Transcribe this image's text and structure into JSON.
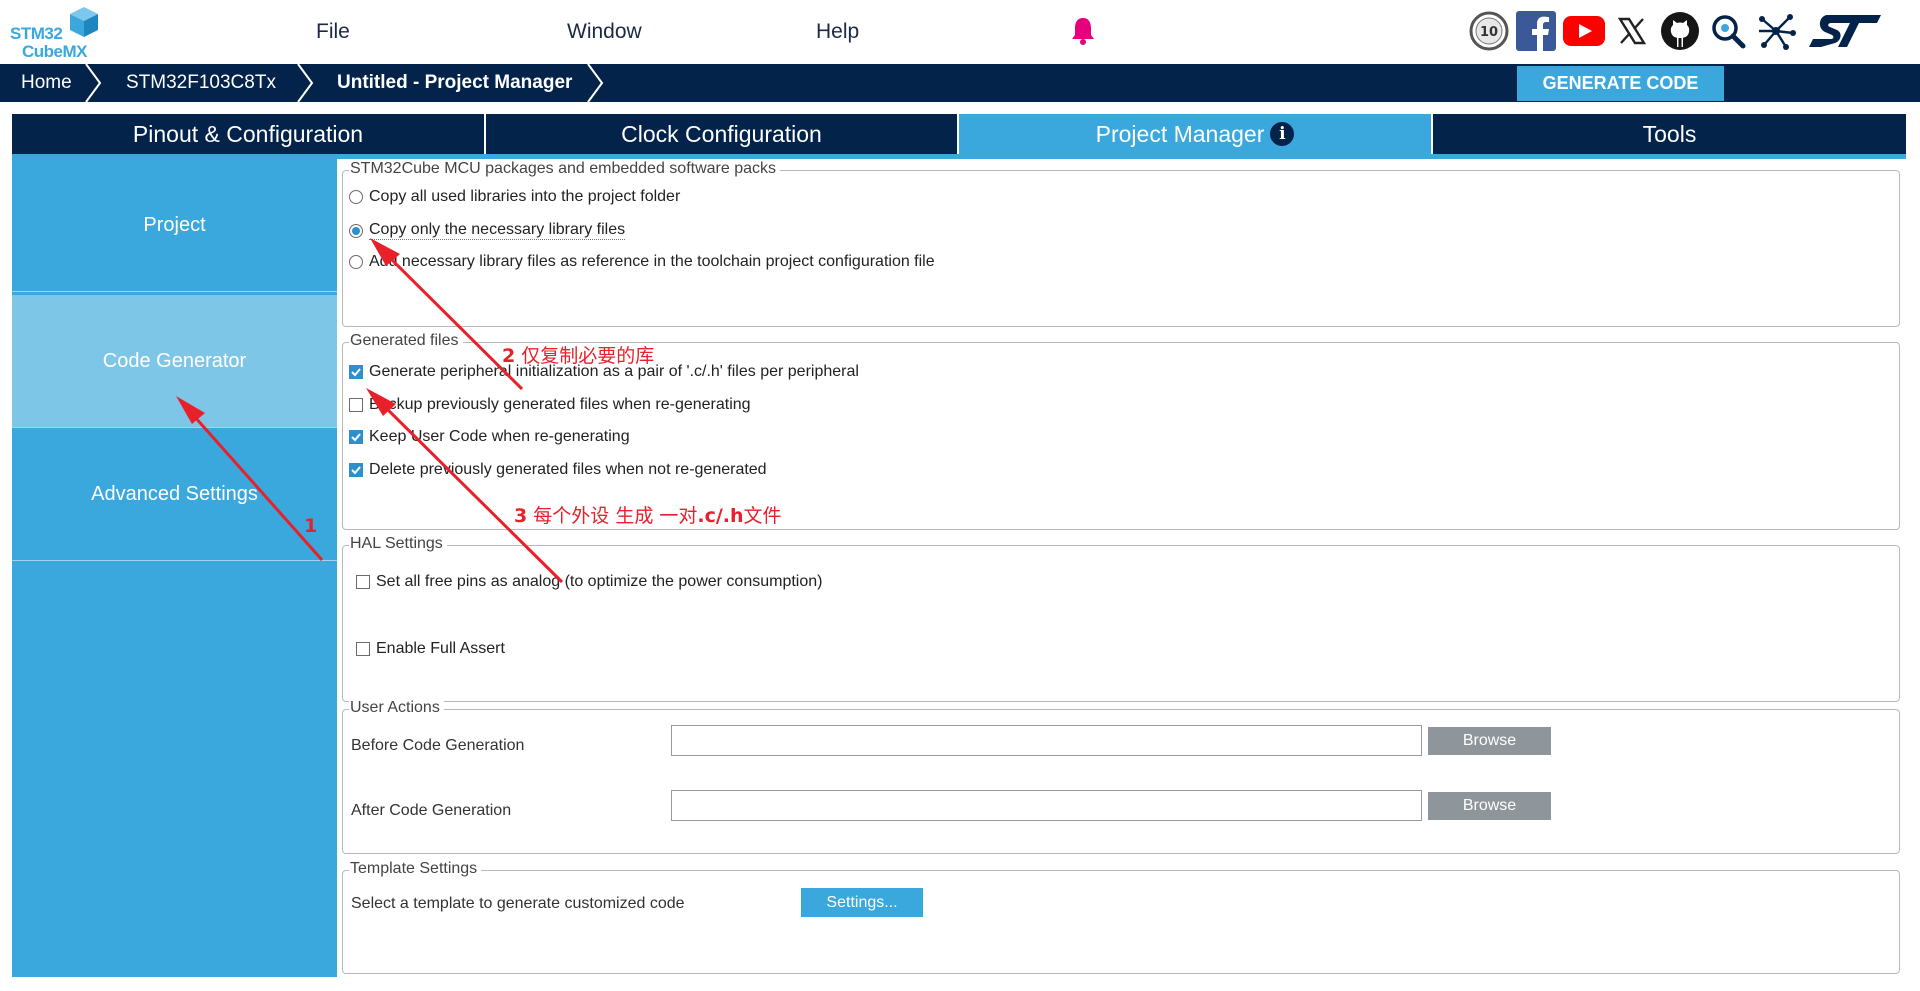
{
  "app": {
    "logo_top": "STM32",
    "logo_bottom": "CubeMX",
    "brand_color": "#3aa8dc",
    "dark_color": "#03234b"
  },
  "menu": {
    "items": [
      {
        "label": "File"
      },
      {
        "label": "Window"
      },
      {
        "label": "Help"
      }
    ],
    "bell_icon": "notification-bell-icon"
  },
  "social_icons": [
    "10-year-anniversary-icon",
    "facebook-icon",
    "youtube-icon",
    "x-icon",
    "github-icon",
    "community-search-icon",
    "network-share-icon",
    "st-logo-icon"
  ],
  "breadcrumb": {
    "items": [
      {
        "label": "Home"
      },
      {
        "label": "STM32F103C8Tx"
      },
      {
        "label": "Untitled - Project Manager"
      }
    ]
  },
  "toolbar": {
    "generate_label": "GENERATE CODE"
  },
  "tabs": [
    {
      "label": "Pinout & Configuration",
      "active": false
    },
    {
      "label": "Clock Configuration",
      "active": false
    },
    {
      "label": "Project Manager",
      "active": true
    },
    {
      "label": "Tools",
      "active": false
    }
  ],
  "sidebar": {
    "items": [
      {
        "label": "Project",
        "active": false
      },
      {
        "label": "Code Generator",
        "active": true
      },
      {
        "label": "Advanced Settings",
        "active": false
      }
    ]
  },
  "packages": {
    "legend": "STM32Cube MCU packages and embedded software packs",
    "options": [
      {
        "label": "Copy all used libraries into the project folder",
        "selected": false
      },
      {
        "label": "Copy only the necessary library files",
        "selected": true
      },
      {
        "label": "Add necessary library files as reference in the toolchain project configuration file",
        "selected": false
      }
    ]
  },
  "generated_files": {
    "legend": "Generated files",
    "options": [
      {
        "label": "Generate peripheral initialization as a pair of '.c/.h' files per peripheral",
        "checked": true
      },
      {
        "label": "Backup previously generated files when re-generating",
        "checked": false
      },
      {
        "label": "Keep User Code when re-generating",
        "checked": true
      },
      {
        "label": "Delete previously generated files when not re-generated",
        "checked": true
      }
    ]
  },
  "hal_settings": {
    "legend": "HAL Settings",
    "options": [
      {
        "label": "Set all free pins as analog (to optimize the power consumption)",
        "checked": false
      },
      {
        "label": "Enable Full Assert",
        "checked": false
      }
    ]
  },
  "user_actions": {
    "legend": "User Actions",
    "before_label": "Before Code Generation",
    "before_value": "",
    "after_label": "After Code Generation",
    "after_value": "",
    "browse_label": "Browse"
  },
  "template_settings": {
    "legend": "Template Settings",
    "label": "Select a template to generate customized code",
    "button_label": "Settings..."
  },
  "annotations": {
    "color": "#e8202a",
    "a1": {
      "num": "1",
      "text": ""
    },
    "a2": {
      "num": "2",
      "text": " 仅复制必要的库"
    },
    "a3": {
      "num": "3",
      "text": " 每个外设 生成 一对",
      "bold": ".c/.h",
      "tail": "文件"
    }
  }
}
